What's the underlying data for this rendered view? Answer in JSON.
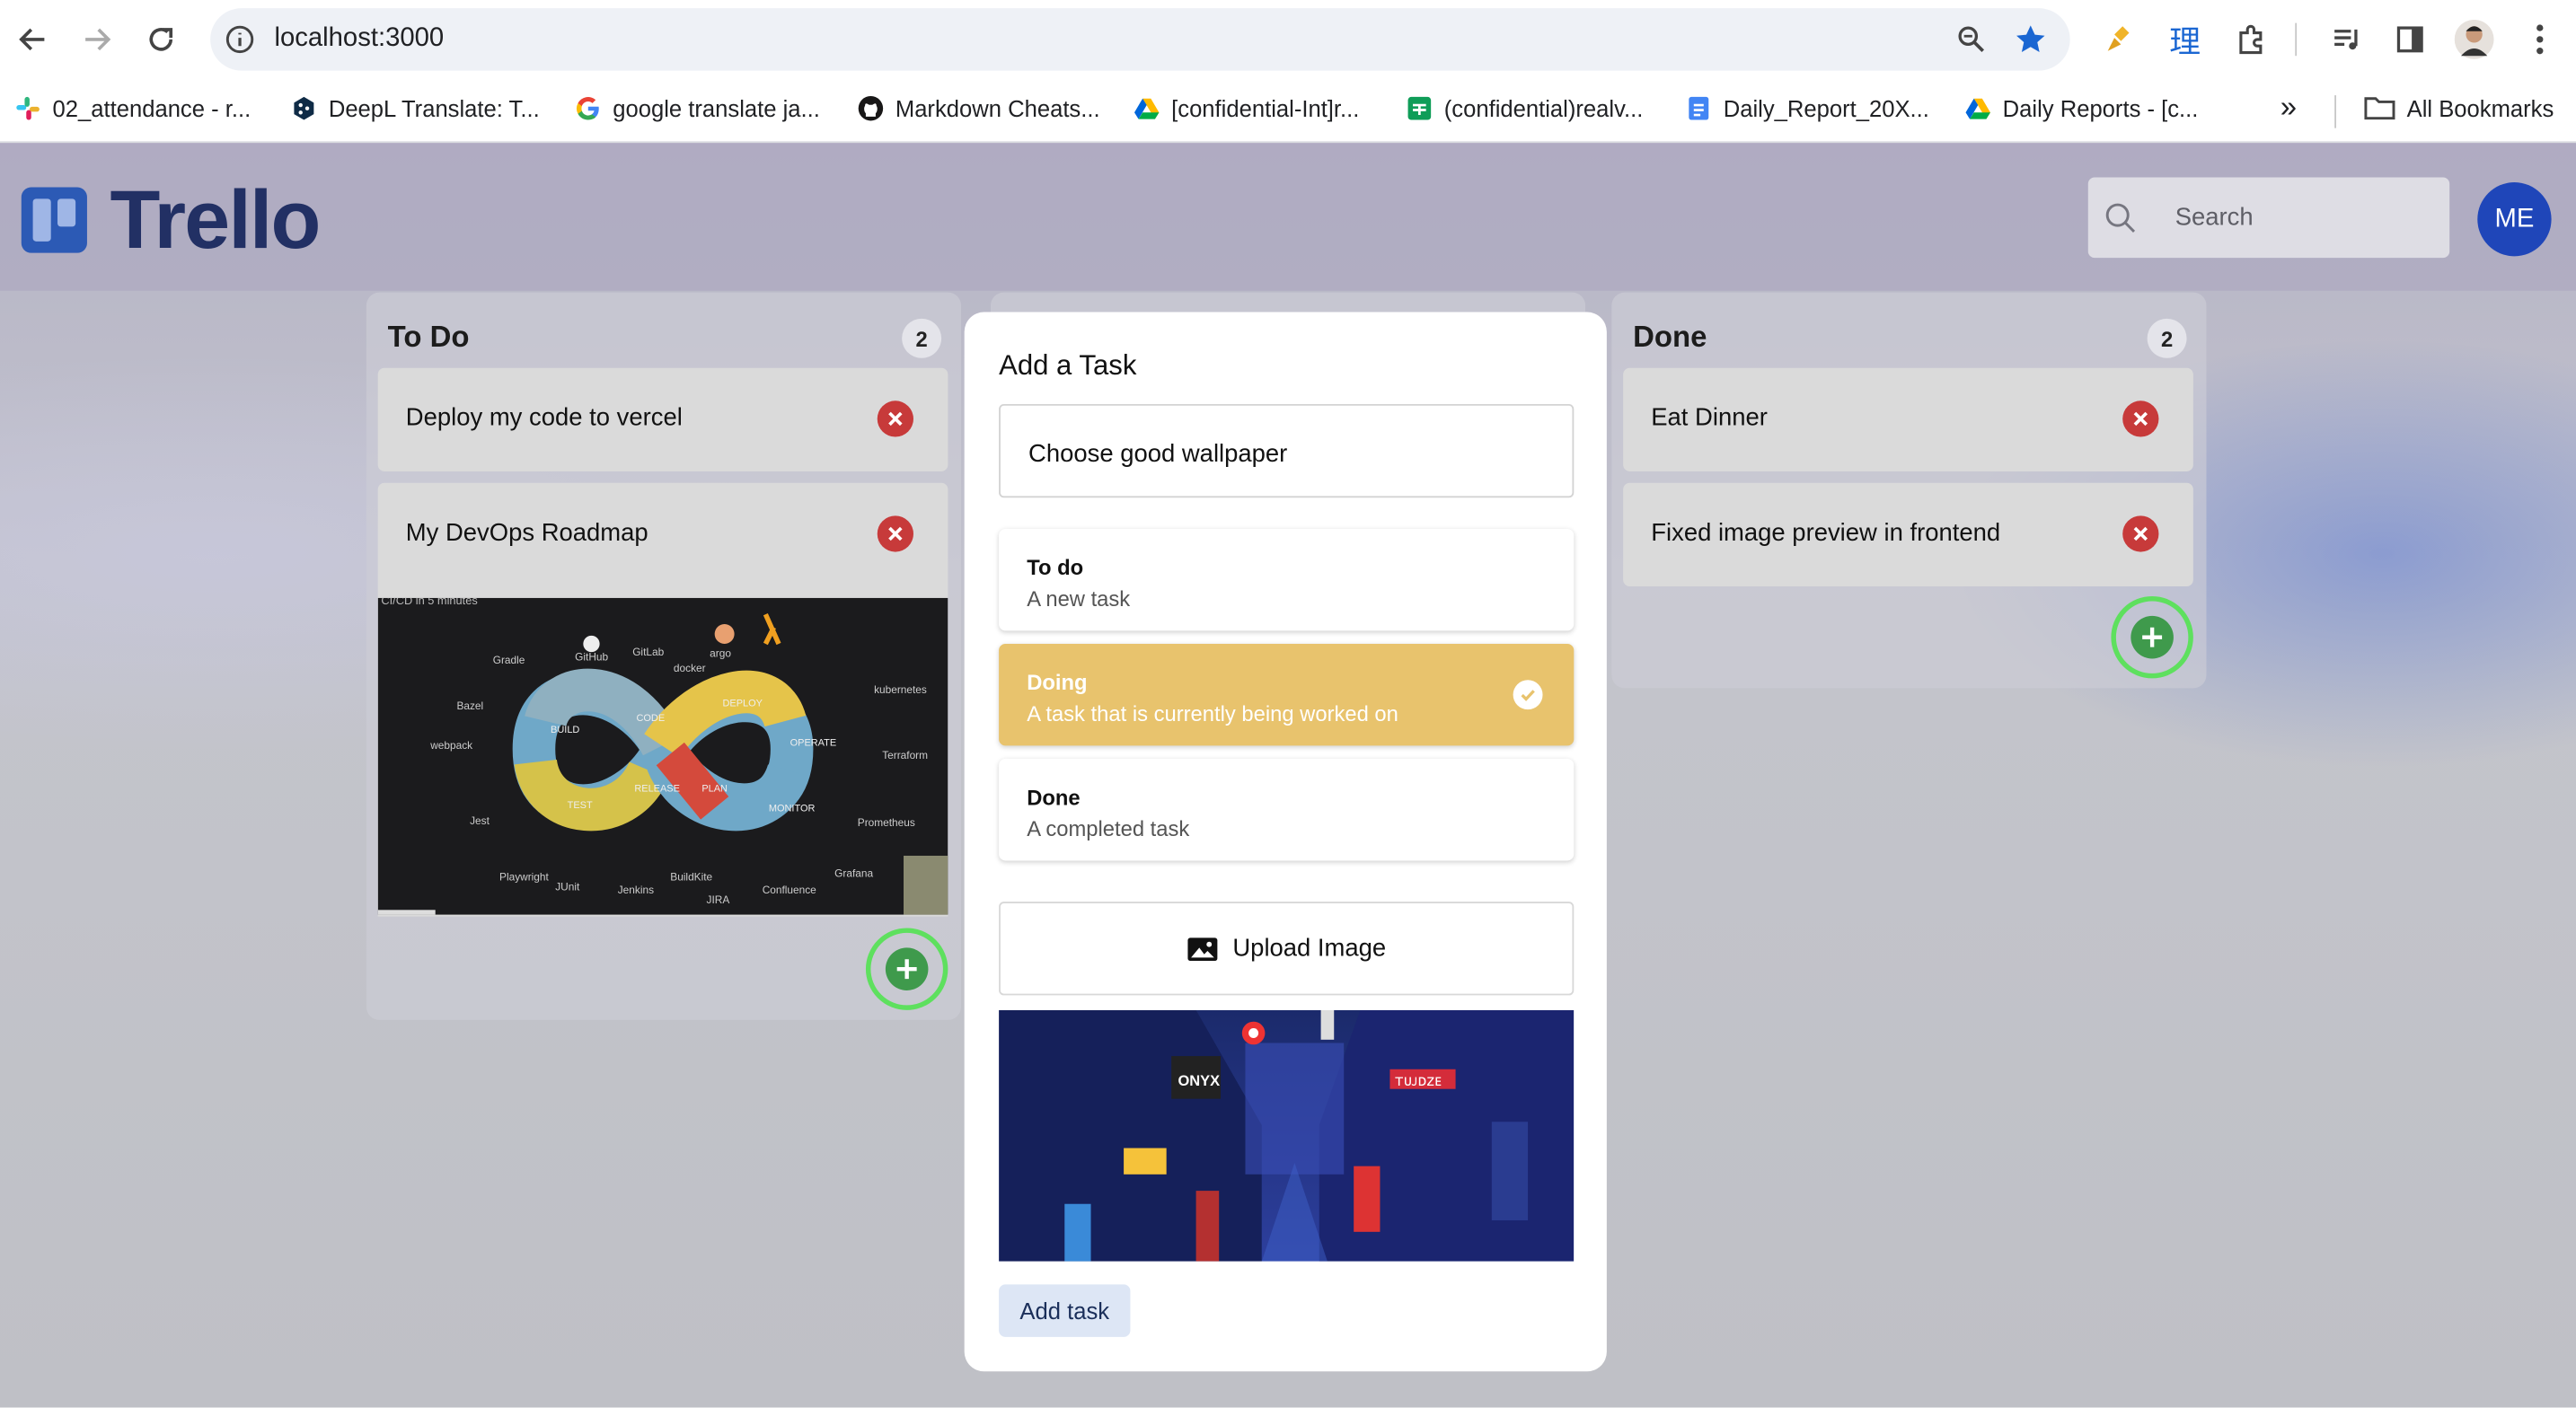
{
  "browser": {
    "url": "localhost:3000",
    "bookmarks": [
      {
        "label": "02_attendance - r...",
        "icon": "slack-icon"
      },
      {
        "label": "DeepL Translate: T...",
        "icon": "deepl-icon"
      },
      {
        "label": "google translate ja...",
        "icon": "google-icon"
      },
      {
        "label": "Markdown Cheats...",
        "icon": "github-icon"
      },
      {
        "label": "[confidential-Int]r...",
        "icon": "drive-icon"
      },
      {
        "label": "(confidential)realv...",
        "icon": "sheets-icon"
      },
      {
        "label": "Daily_Report_20X...",
        "icon": "docs-icon"
      },
      {
        "label": "Daily Reports - [c...",
        "icon": "drive-icon"
      }
    ],
    "all_bookmarks_label": "All Bookmarks",
    "more_label": "»",
    "extension_label": "理"
  },
  "app": {
    "brand": "Trello",
    "search_placeholder": "Search",
    "avatar_initials": "ME"
  },
  "columns": [
    {
      "title": "To Do",
      "count": "2",
      "cards": [
        "Deploy my code to vercel",
        "My DevOps Roadmap"
      ]
    },
    {
      "title": "Done",
      "count": "2",
      "cards": [
        "Eat Dinner",
        "Fixed image preview in frontend"
      ]
    }
  ],
  "roadmap_image": {
    "caption": "CI/CD in 5 minutes",
    "stages": [
      "BUILD",
      "CODE",
      "DEPLOY",
      "OPERATE",
      "MONITOR",
      "PLAN",
      "RELEASE",
      "TEST"
    ],
    "tools": [
      "Gradle",
      "GitHub",
      "GitLab",
      "docker",
      "argo",
      "kubernetes",
      "Bazel",
      "webpack",
      "Terraform",
      "Jest",
      "Playwright",
      "JUnit",
      "Jenkins",
      "BuildKite",
      "JIRA",
      "Confluence",
      "Prometheus",
      "Grafana"
    ]
  },
  "modal": {
    "title": "Add a Task",
    "task_value": "Choose good wallpaper",
    "options": [
      {
        "name": "To do",
        "desc": "A new task",
        "selected": false
      },
      {
        "name": "Doing",
        "desc": "A task that is currently being worked on",
        "selected": true
      },
      {
        "name": "Done",
        "desc": "A completed task",
        "selected": false
      }
    ],
    "upload_label": "Upload Image",
    "submit_label": "Add task",
    "preview_signs": [
      "ONYX",
      "ᴛᴜᴊᴅᴢᴇ"
    ]
  },
  "colors": {
    "brand": "#2c5ab5",
    "selected_option": "#e8c36d",
    "delete": "#c73a3a",
    "add_fab": "#3f9a4c",
    "avatar": "#1f46b9"
  }
}
